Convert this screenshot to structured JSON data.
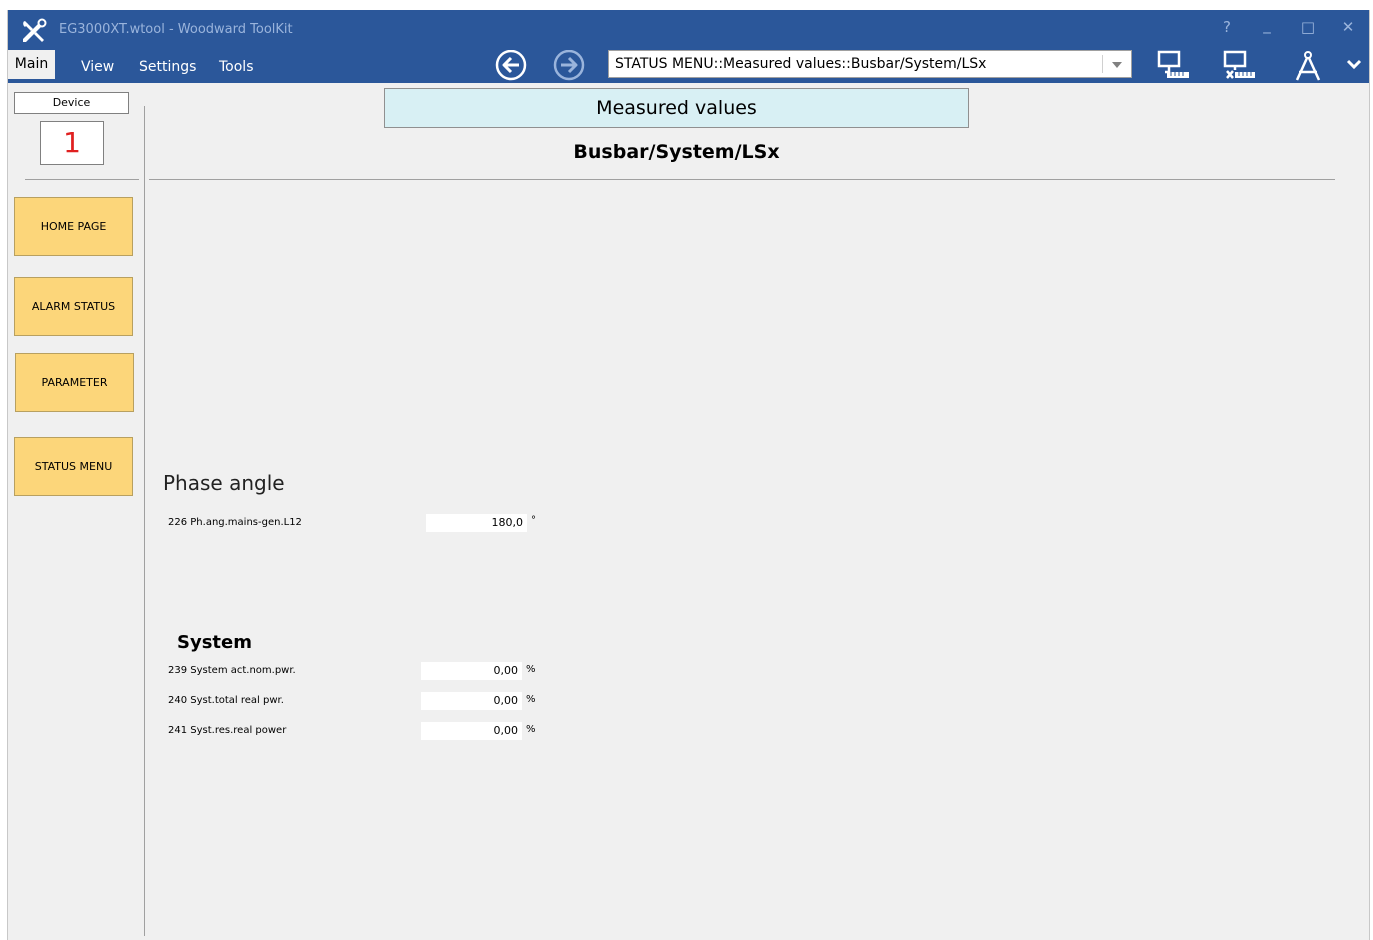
{
  "window": {
    "title": "EG3000XT.wtool - Woodward ToolKit",
    "help_label": "?",
    "minimize_label": "_",
    "maximize_label": "□",
    "close_label": "✕"
  },
  "menu": {
    "items": [
      "Main",
      "View",
      "Settings",
      "Tools"
    ],
    "active": "Main"
  },
  "navigation": {
    "path": "STATUS MENU::Measured values::Busbar/System/LSx"
  },
  "sidebar": {
    "device_label": "Device",
    "device_number": "1",
    "buttons": [
      "HOME PAGE",
      "ALARM STATUS",
      "PARAMETER",
      "STATUS MENU"
    ]
  },
  "page": {
    "header": "Measured values",
    "title": "Busbar/System/LSx"
  },
  "sections": {
    "phase": {
      "heading": "Phase angle",
      "params": [
        {
          "label": "226 Ph.ang.mains-gen.L12",
          "value": "180,0",
          "unit": "°"
        }
      ]
    },
    "system": {
      "heading": "System",
      "params": [
        {
          "label": "239 System act.nom.pwr.",
          "value": "0,00",
          "unit": "%"
        },
        {
          "label": "240 Syst.total real pwr.",
          "value": "0,00",
          "unit": "%"
        },
        {
          "label": "241 Syst.res.real power",
          "value": "0,00",
          "unit": "%"
        }
      ]
    }
  },
  "colors": {
    "titlebar": "#2b579a",
    "header_box": "#d8f0f4",
    "nav_card": "#fcd67a",
    "device_number": "#e02020"
  }
}
